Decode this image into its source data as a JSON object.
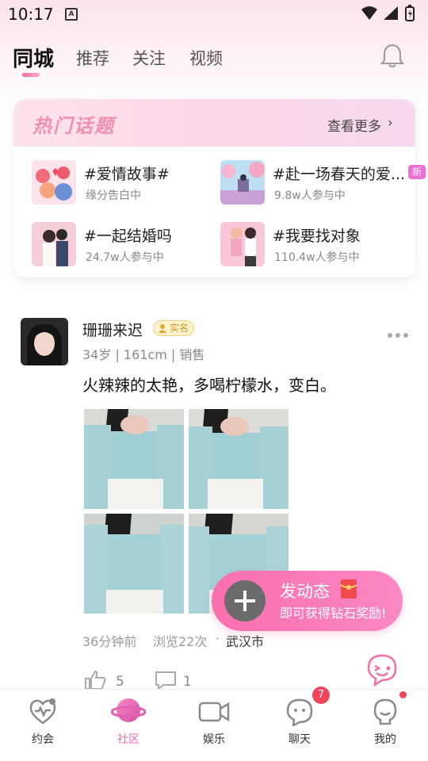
{
  "status_bar": {
    "time": "10:17",
    "a_icon": "A"
  },
  "tabs": [
    {
      "label": "同城",
      "active": true
    },
    {
      "label": "推荐",
      "active": false
    },
    {
      "label": "关注",
      "active": false
    },
    {
      "label": "视频",
      "active": false
    }
  ],
  "topics": {
    "title": "热门话题",
    "more": "查看更多",
    "items": [
      {
        "name": "#爱情故事#",
        "sub": "缘分告白中"
      },
      {
        "name": "#赴一场春天的爱...",
        "sub": "9.8w人参与中",
        "badge": "新"
      },
      {
        "name": "#一起结婚吗",
        "sub": "24.7w人参与中"
      },
      {
        "name": "#我要找对象",
        "sub": "110.4w人参与中"
      }
    ]
  },
  "post": {
    "user_name": "珊珊来迟",
    "verify": "实名",
    "meta": "34岁 | 161cm | 销售",
    "text": "火辣辣的太艳，多喝柠檬水，变白。",
    "time": "36分钟前",
    "views": "浏览22次",
    "separator": "·",
    "city": "武汉市",
    "likes": "5",
    "comments": "1"
  },
  "cta": {
    "title": "发动态",
    "subtitle": "即可获得钻石奖励!"
  },
  "bottom_nav": [
    {
      "label": "约会",
      "icon": "heartbeat-icon"
    },
    {
      "label": "社区",
      "icon": "planet-icon",
      "active": true
    },
    {
      "label": "娱乐",
      "icon": "video-camera-icon"
    },
    {
      "label": "聊天",
      "icon": "chat-face-icon",
      "badge": "7"
    },
    {
      "label": "我的",
      "icon": "profile-icon",
      "dot": true
    }
  ],
  "colors": {
    "accent": "#f06aa8",
    "badge_red": "#f2445a",
    "cta": "#f96fae"
  }
}
